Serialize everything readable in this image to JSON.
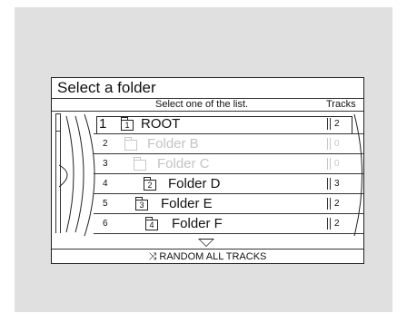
{
  "screen": {
    "title": "Select a folder",
    "subtitle": "Select one of the list.",
    "tracks_header": "Tracks"
  },
  "folders": [
    {
      "num": "1",
      "icon_num": "1",
      "name": "ROOT",
      "tracks": "2",
      "state": "selected"
    },
    {
      "num": "2",
      "icon_num": "",
      "name": "Folder B",
      "tracks": "0",
      "state": "disabled"
    },
    {
      "num": "3",
      "icon_num": "",
      "name": "Folder C",
      "tracks": "0",
      "state": "disabled"
    },
    {
      "num": "4",
      "icon_num": "2",
      "name": "Folder D",
      "tracks": "3",
      "state": "normal"
    },
    {
      "num": "5",
      "icon_num": "3",
      "name": "Folder E",
      "tracks": "2",
      "state": "normal"
    },
    {
      "num": "6",
      "icon_num": "4",
      "name": "Folder F",
      "tracks": "2",
      "state": "normal"
    }
  ],
  "footer": {
    "shuffle_icon": "shuffle-icon",
    "label": "RANDOM ALL TRACKS"
  },
  "colors": {
    "disabled_text": "#c4c4c4",
    "background": "#e0e0e0"
  }
}
